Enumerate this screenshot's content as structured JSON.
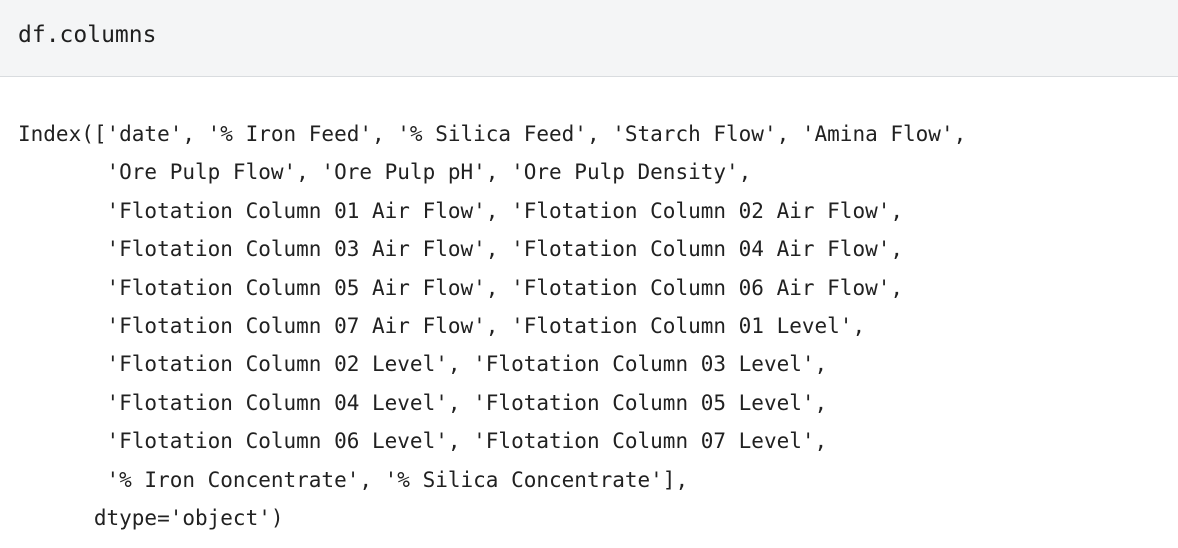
{
  "input_cell": {
    "code": "df.columns"
  },
  "output": {
    "lines": [
      "Index(['date', '% Iron Feed', '% Silica Feed', 'Starch Flow', 'Amina Flow',",
      "       'Ore Pulp Flow', 'Ore Pulp pH', 'Ore Pulp Density',",
      "       'Flotation Column 01 Air Flow', 'Flotation Column 02 Air Flow',",
      "       'Flotation Column 03 Air Flow', 'Flotation Column 04 Air Flow',",
      "       'Flotation Column 05 Air Flow', 'Flotation Column 06 Air Flow',",
      "       'Flotation Column 07 Air Flow', 'Flotation Column 01 Level',",
      "       'Flotation Column 02 Level', 'Flotation Column 03 Level',",
      "       'Flotation Column 04 Level', 'Flotation Column 05 Level',",
      "       'Flotation Column 06 Level', 'Flotation Column 07 Level',",
      "       '% Iron Concentrate', '% Silica Concentrate'],",
      "      dtype='object')"
    ]
  }
}
